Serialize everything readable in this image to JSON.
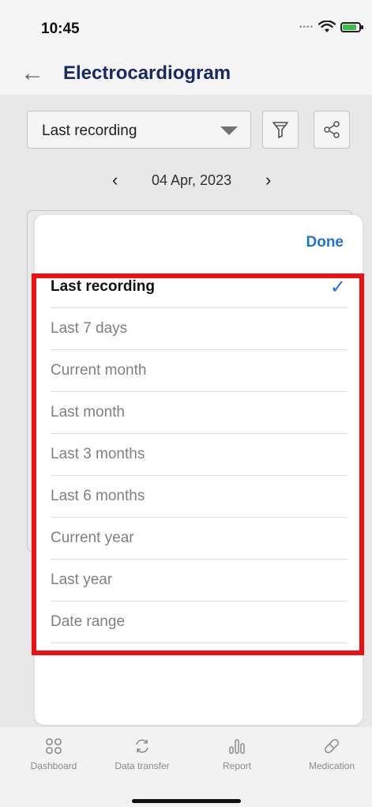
{
  "status_bar": {
    "time": "10:45"
  },
  "header": {
    "title": "Electrocardiogram"
  },
  "filter": {
    "selected": "Last recording"
  },
  "date_nav": {
    "date": "04 Apr, 2023",
    "prev": "‹",
    "next": "›"
  },
  "sheet": {
    "done_label": "Done",
    "check": "✓",
    "options": [
      {
        "label": "Last recording"
      },
      {
        "label": "Last 7 days"
      },
      {
        "label": "Current month"
      },
      {
        "label": "Last month"
      },
      {
        "label": "Last 3 months"
      },
      {
        "label": "Last 6 months"
      },
      {
        "label": "Current year"
      },
      {
        "label": "Last year"
      },
      {
        "label": "Date range"
      }
    ]
  },
  "bottom_nav": [
    {
      "label": "Dashboard",
      "icon": "dashboard-icon"
    },
    {
      "label": "Data transfer",
      "icon": "data-transfer-icon"
    },
    {
      "label": "Report",
      "icon": "report-icon"
    },
    {
      "label": "Medication",
      "icon": "medication-icon"
    }
  ],
  "colors": {
    "accent": "#1f73d6",
    "title": "#1a2b6b",
    "highlight": "#ee1111"
  }
}
